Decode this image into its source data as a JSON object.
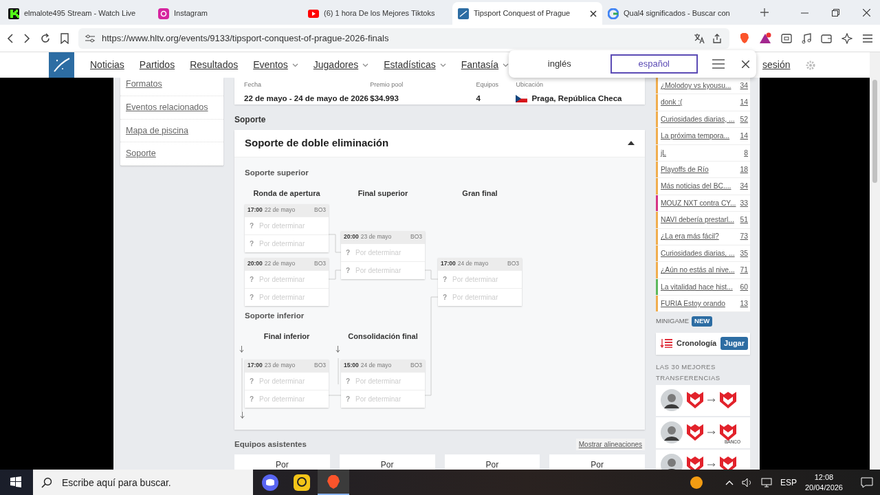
{
  "browser": {
    "tabs": [
      {
        "title": "elmalote495 Stream - Watch Live",
        "selected": false
      },
      {
        "title": "Instagram",
        "selected": false
      },
      {
        "title": "(6) 1 hora De los Mejores Tiktoks",
        "selected": false
      },
      {
        "title": "Tipsport Conquest of Prague",
        "selected": true
      },
      {
        "title": "Qual4 significados - Buscar con",
        "selected": false
      }
    ],
    "url": "https://www.hltv.org/events/9133/tipsport-conquest-of-prague-2026-finals"
  },
  "site_nav": {
    "items": [
      {
        "label": "Noticias",
        "dropdown": false
      },
      {
        "label": "Partidos",
        "dropdown": false
      },
      {
        "label": "Resultados",
        "dropdown": false
      },
      {
        "label": "Eventos",
        "dropdown": true
      },
      {
        "label": "Jugadores",
        "dropdown": true
      },
      {
        "label": "Estadísticas",
        "dropdown": true
      },
      {
        "label": "Fantasía",
        "dropdown": true
      }
    ],
    "login": "sesión"
  },
  "translate_popup": {
    "languages": [
      {
        "label": "inglés",
        "selected": false
      },
      {
        "label": "español",
        "selected": true
      }
    ]
  },
  "left_menu": [
    "Formatos",
    "Eventos relacionados",
    "Mapa de piscina",
    "Soporte"
  ],
  "event_info": [
    {
      "label": "Fecha",
      "value": "22 de mayo - 24 de mayo de 2026"
    },
    {
      "label": "Premio pool",
      "value": "$34.993"
    },
    {
      "label": "Equipos",
      "value": "4"
    },
    {
      "label": "Ubicación",
      "value": "Praga, República Checa",
      "flag": true
    }
  ],
  "section_label": "Soporte",
  "bracket": {
    "title": "Soporte de doble eliminación",
    "expanded": true,
    "upper": {
      "title": "Soporte superior",
      "rounds": [
        {
          "title": "Ronda de apertura",
          "matches": [
            {
              "time": "17:00",
              "date": "22 de mayo",
              "format": "BO3",
              "teams": [
                {
                  "logo": "?",
                  "name": "Por determinar"
                },
                {
                  "logo": "?",
                  "name": "Por determinar"
                }
              ]
            },
            {
              "time": "20:00",
              "date": "22 de mayo",
              "format": "BO3",
              "teams": [
                {
                  "logo": "?",
                  "name": "Por determinar"
                },
                {
                  "logo": "?",
                  "name": "Por determinar"
                }
              ]
            }
          ]
        },
        {
          "title": "Final superior",
          "matches": [
            {
              "time": "20:00",
              "date": "23 de mayo",
              "format": "BO3",
              "teams": [
                {
                  "logo": "?",
                  "name": "Por determinar"
                },
                {
                  "logo": "?",
                  "name": "Por determinar"
                }
              ]
            }
          ]
        },
        {
          "title": "Gran final",
          "matches": [
            {
              "time": "17:00",
              "date": "24 de mayo",
              "format": "BO3",
              "teams": [
                {
                  "logo": "?",
                  "name": "Por determinar"
                },
                {
                  "logo": "?",
                  "name": "Por determinar"
                }
              ]
            }
          ]
        }
      ]
    },
    "lower": {
      "title": "Soporte inferior",
      "rounds": [
        {
          "title": "Final inferior",
          "matches": [
            {
              "time": "17:00",
              "date": "23 de mayo",
              "format": "BO3",
              "teams": [
                {
                  "logo": "?",
                  "name": "Por determinar"
                },
                {
                  "logo": "?",
                  "name": "Por determinar"
                }
              ]
            }
          ]
        },
        {
          "title": "Consolidación final",
          "matches": [
            {
              "time": "15:00",
              "date": "24 de mayo",
              "format": "BO3",
              "teams": [
                {
                  "logo": "?",
                  "name": "Por determinar"
                },
                {
                  "logo": "?",
                  "name": "Por determinar"
                }
              ]
            }
          ]
        }
      ]
    }
  },
  "attending": {
    "title": "Equipos asistentes",
    "link": "Mostrar alineaciones",
    "teams": [
      "Por",
      "Por",
      "Por",
      "Por"
    ]
  },
  "threads": [
    {
      "title": "¿Molodoy vs kyousu...",
      "count": "34",
      "color": "#f0ad4e"
    },
    {
      "title": "donk :(",
      "count": "14",
      "color": "#f0ad4e"
    },
    {
      "title": "Curiosidades diarias, ...",
      "count": "52",
      "color": "#f0ad4e"
    },
    {
      "title": "La próxima tempora...",
      "count": "14",
      "color": "#f0ad4e"
    },
    {
      "title": "jL",
      "count": "8",
      "color": "#f0ad4e"
    },
    {
      "title": "Playoffs de Río",
      "count": "18",
      "color": "#f0ad4e"
    },
    {
      "title": "Más noticias del BC....",
      "count": "34",
      "color": "#f0ad4e"
    },
    {
      "title": "MOUZ NXT contra CY...",
      "count": "33",
      "color": "#d63384"
    },
    {
      "title": "NAVI debería prestarl...",
      "count": "51",
      "color": "#f0ad4e"
    },
    {
      "title": "¿La era más fácil?",
      "count": "73",
      "color": "#f0ad4e"
    },
    {
      "title": "Curiosidades diarias, ...",
      "count": "35",
      "color": "#f0ad4e"
    },
    {
      "title": "¿Aún no estás al nive...",
      "count": "71",
      "color": "#f0ad4e"
    },
    {
      "title": "La vitalidad hace hist...",
      "count": "60",
      "color": "#5cb85c"
    },
    {
      "title": "FURIA Estoy orando",
      "count": "13",
      "color": "#f0ad4e"
    }
  ],
  "minigame": {
    "label": "MINIGAME",
    "badge": "NEW",
    "name": "Cronología",
    "button": "Jugar"
  },
  "transfers": {
    "title": "LAS 30 MEJORES TRANSFERENCIAS",
    "items": [
      {
        "kind": "player"
      },
      {
        "kind": "player",
        "note": "BANCO"
      },
      {
        "kind": "player"
      }
    ]
  },
  "taskbar": {
    "search_placeholder": "Escribe aquí para buscar.",
    "language": "ESP",
    "time": "12:08",
    "date": "20/04/2026"
  }
}
